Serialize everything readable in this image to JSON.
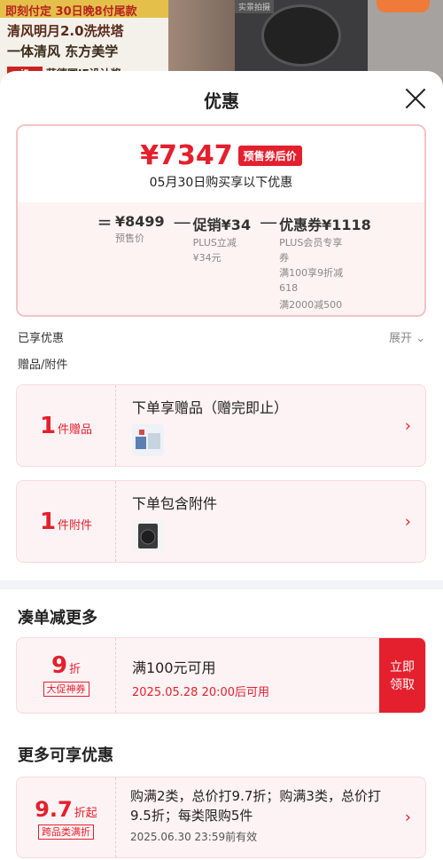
{
  "banner": {
    "strip_text": "即刻付定 30日晚8付尾款",
    "line1": "清风明月2.0洗烘塔",
    "line2": "一体清风 东方美学",
    "line3": "获德国IF设计奖",
    "logo_text": "iF",
    "dryer_tag": "实景拍摄"
  },
  "sheet": {
    "title": "优惠",
    "close_icon": "close-icon"
  },
  "price": {
    "final": "¥7347",
    "badge": "预售券后价",
    "date_line": "05月30日购买享以下优惠",
    "eq": "=",
    "minus": "—",
    "base_value": "¥8499",
    "base_label": "预售价",
    "promo_value": "促销¥34",
    "promo_sub1": "PLUS立减",
    "promo_sub2": "¥34元",
    "coupon_value": "优惠券¥1118",
    "coupon_sub1": "PLUS会员专享",
    "coupon_sub2": "券",
    "coupon_sub3": "满100享9折减",
    "coupon_sub4": "618",
    "coupon_sub5": "满2000减500"
  },
  "enjoyed": {
    "label": "已享优惠",
    "expand": "展开",
    "gift_label": "赠品/附件"
  },
  "gift_card": {
    "count": "1",
    "unit": "件赠品",
    "title": "下单享赠品（赠完即止）"
  },
  "accessory_card": {
    "count": "1",
    "unit": "件附件",
    "title": "下单包含附件"
  },
  "section1": {
    "title": "凑单减更多"
  },
  "coupon": {
    "discount": "9",
    "unit": "折",
    "tag": "大促神券",
    "title": "满100元可用",
    "date": "2025.05.28 20:00后可用",
    "button": "立即领取"
  },
  "section2": {
    "title": "更多可享优惠"
  },
  "more_offer": {
    "discount": "9.7",
    "unit": "折起",
    "tag": "跨品类满折",
    "title": "购满2类，总价打9.7折；购满3类，总价打9.5折；每类限购5件",
    "date": "2025.06.30 23:59前有效"
  },
  "colors": {
    "accent": "#e4202e",
    "card_bg": "#fdf3f4"
  }
}
